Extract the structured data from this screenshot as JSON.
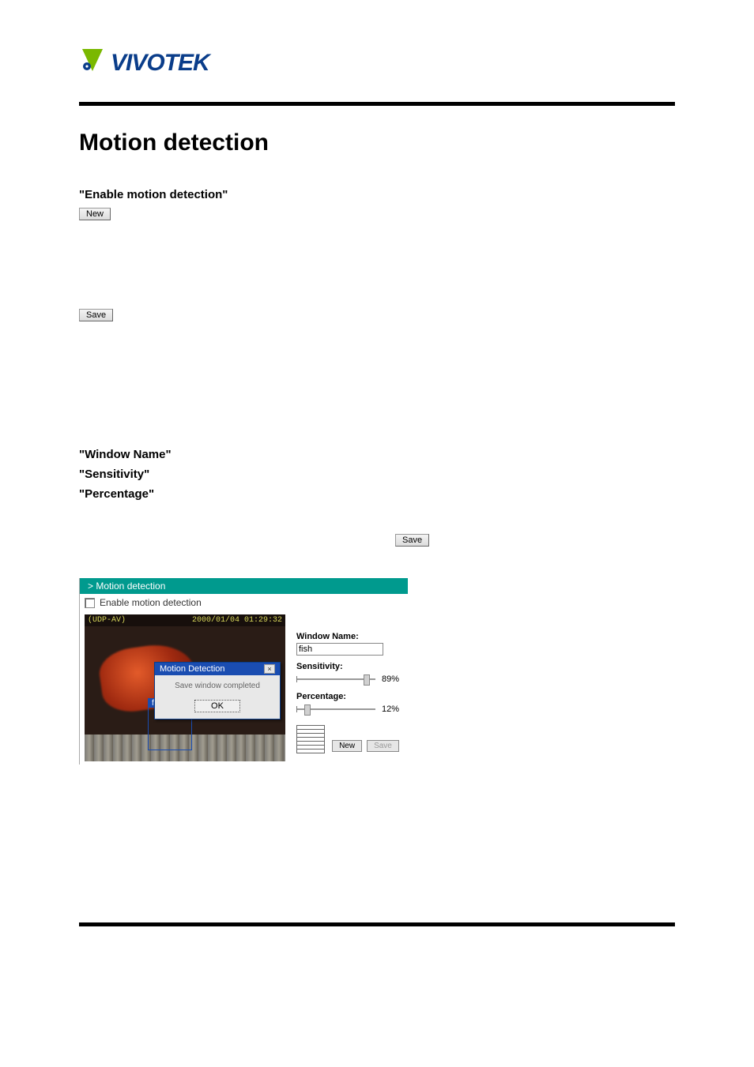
{
  "logo": {
    "text": "VIVOTEK"
  },
  "page": {
    "title": "Motion detection",
    "enable_label": "\"Enable motion detection\"",
    "new_button": "New",
    "save_button": "Save",
    "fields": {
      "window_name": "\"Window Name\"",
      "sensitivity": "\"Sensitivity\"",
      "percentage": "\"Percentage\""
    },
    "mid_save": "Save"
  },
  "shot": {
    "header": "> Motion detection",
    "enable_checkbox_label": "Enable motion detection",
    "video": {
      "top_left": "(UDP-AV)",
      "top_right": "2000/01/04 01:29:32",
      "md_window_label": "fish"
    },
    "dialog": {
      "title": "Motion Detection",
      "message": "Save window completed",
      "ok": "OK"
    },
    "panel": {
      "window_name_label": "Window Name:",
      "window_name_value": "fish",
      "sensitivity_label": "Sensitivity:",
      "sensitivity_value": "89%",
      "percentage_label": "Percentage:",
      "percentage_value": "12%",
      "new_button": "New",
      "save_button": "Save"
    }
  }
}
